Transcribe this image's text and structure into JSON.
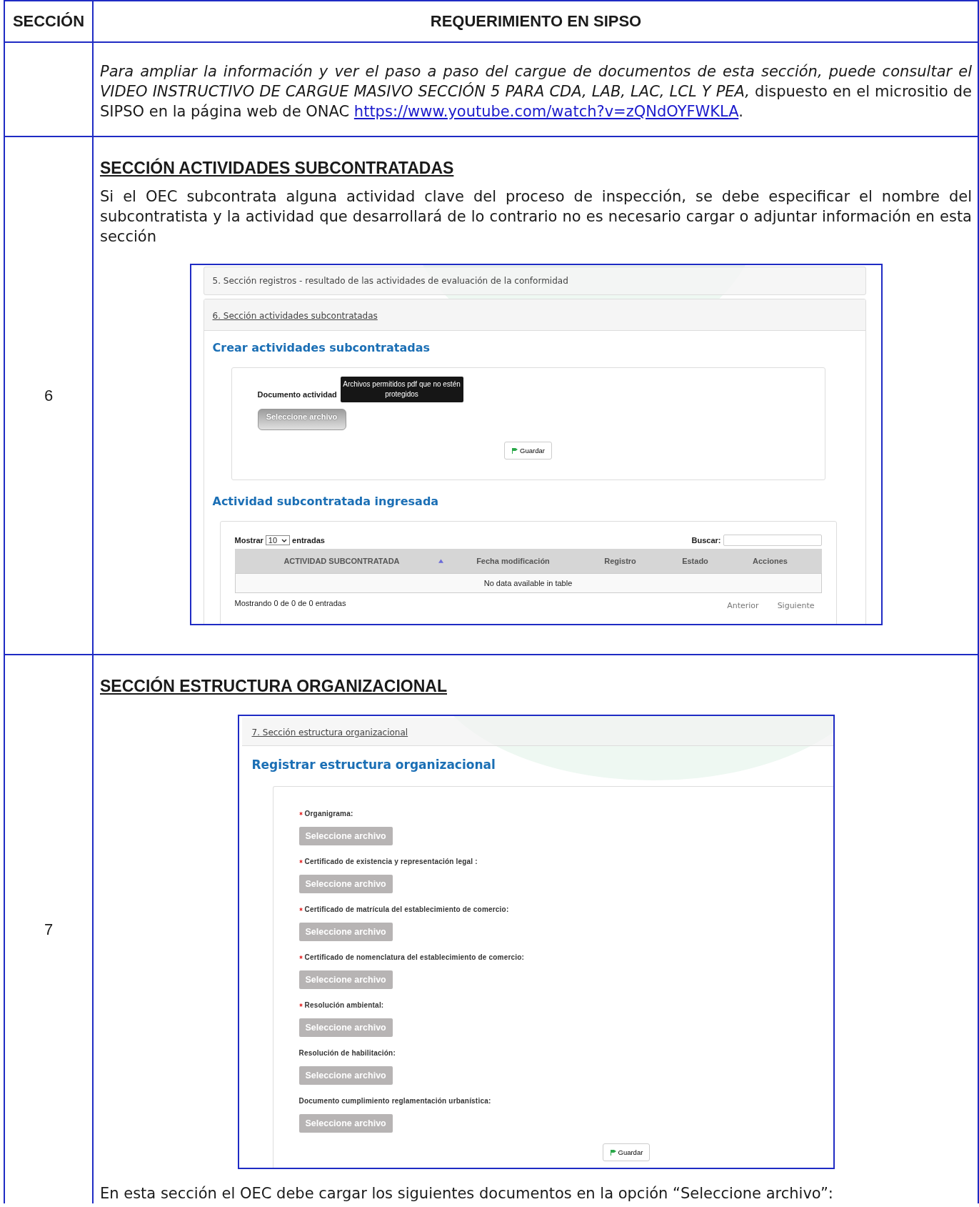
{
  "table": {
    "columns": [
      "SECCIÓN",
      "REQUERIMIENTO EN SIPSO"
    ],
    "rows": [
      {
        "number": "",
        "blocks": [
          {
            "kind": "linked_paragraph",
            "text": "*Para ampliar la información y ver el paso a paso del cargue de documentos de esta sección, puede consultar el VIDEO INSTRUCTIVO DE CARGUE MASIVO SECCIÓN 5 PARA CDA, LAB, LAC, LCL Y PEA,* dispuesto en el micrositio de SIPSO en la página web de ONAC",
            "link": "https://www.youtube.com/watch?v=zQNdOYFWKLA",
            "after": "."
          }
        ]
      },
      {
        "number": "6",
        "blocks": [
          {
            "kind": "heading",
            "text": "SECCIÓN ACTIVIDADES SUBCONTRATADAS"
          },
          {
            "kind": "paragraph",
            "text": "Si el OEC subcontrata alguna actividad clave del proceso de inspección, se debe especificar el nombre del subcontratista y la actividad que desarrollará de lo contrario no es necesario cargar o adjuntar información en esta sección"
          },
          {
            "kind": "subcontract_screen",
            "collapsed_panel": "5. Sección registros - resultado de las actividades de evaluación de la conformidad",
            "open_panel": "6. Sección actividades subcontratadas",
            "form_title": "Crear actividades subcontratadas",
            "field_label": "Documento actividad",
            "tooltip": "Archivos permitidos pdf que no estén protegidos",
            "file_button": "Seleccione archivo",
            "save_button": "Guardar",
            "table_title": "Actividad subcontratada ingresada",
            "show_label": "Mostrar",
            "page_size": "10",
            "entries_label": "entradas",
            "search_label": "Buscar:",
            "columns": [
              {
                "label": "ACTIVIDAD SUBCONTRATADA",
                "sorted": true
              },
              {
                "label": "Fecha modificación",
                "sorted": false
              },
              {
                "label": "Registro",
                "sorted": false
              },
              {
                "label": "Estado",
                "sorted": false
              },
              {
                "label": "Acciones",
                "sorted": false
              }
            ],
            "empty_text": "No data available in table",
            "info": "Mostrando 0 de 0 de 0 entradas",
            "pager": [
              "Anterior",
              "Siguiente"
            ]
          }
        ]
      },
      {
        "number": "7",
        "blocks": [
          {
            "kind": "heading",
            "text": "SECCIÓN ESTRUCTURA ORGANIZACIONAL"
          },
          {
            "kind": "structure_screen",
            "open_panel": "7. Sección estructura organizacional",
            "form_title": "Registrar estructura organizacional",
            "fields": [
              {
                "label": "Organigrama:",
                "required": true,
                "button": "Seleccione archivo"
              },
              {
                "label": "Certificado de existencia y representación legal :",
                "required": true,
                "button": "Seleccione archivo"
              },
              {
                "label": "Certificado de matrícula del establecimiento de comercio:",
                "required": true,
                "button": "Seleccione archivo"
              },
              {
                "label": "Certificado de nomenclatura del establecimiento de comercio:",
                "required": true,
                "button": "Seleccione archivo"
              },
              {
                "label": "Resolución ambiental:",
                "required": true,
                "button": "Seleccione archivo"
              },
              {
                "label": "Resolución de habilitación:",
                "required": false,
                "button": "Seleccione archivo"
              },
              {
                "label": "Documento cumplimiento reglamentación urbanística:",
                "required": false,
                "button": "Seleccione archivo"
              }
            ],
            "save_button": "Guardar"
          },
          {
            "kind": "paragraph",
            "text": "En esta sección el OEC debe cargar los siguientes documentos en la opción “Seleccione archivo”:"
          }
        ]
      }
    ]
  }
}
